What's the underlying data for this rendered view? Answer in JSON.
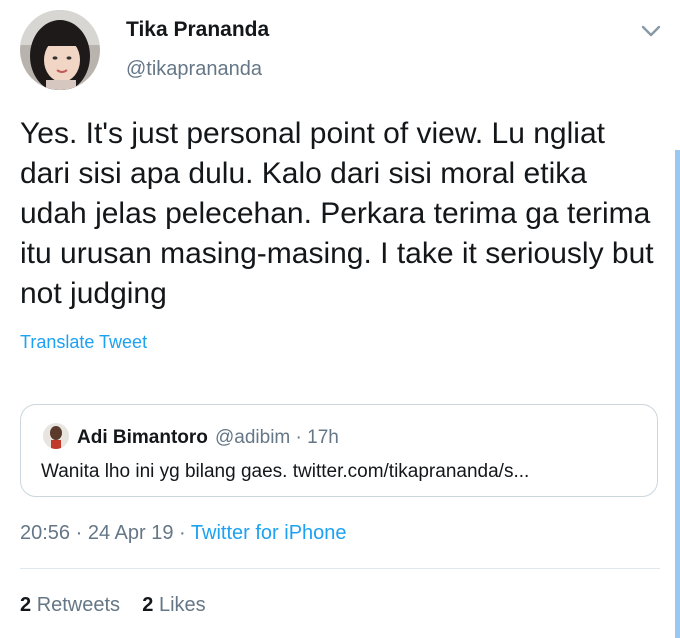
{
  "user": {
    "name": "Tika Prananda",
    "handle": "@tikaprananda"
  },
  "tweet": {
    "text": "Yes. It's just personal point of view. Lu ngliat dari sisi apa dulu. Kalo dari sisi moral etika udah jelas pelecehan. Perkara terima ga terima itu urusan masing-masing. I take it seriously but not judging",
    "translate_label": "Translate Tweet"
  },
  "quoted": {
    "name": "Adi Bimantoro",
    "handle": "@adibim",
    "separator": "·",
    "time": "17h",
    "text": "Wanita lho ini yg bilang gaes. twitter.com/tikaprananda/s..."
  },
  "meta": {
    "time": "20:56",
    "sep1": "·",
    "date": "24 Apr 19",
    "sep2": "·",
    "source": "Twitter for iPhone"
  },
  "stats": {
    "retweets_count": "2",
    "retweets_label": "Retweets",
    "likes_count": "2",
    "likes_label": "Likes"
  },
  "colors": {
    "accent": "#1da1f2",
    "secondary_text": "#657786",
    "border": "#ccd6dd"
  },
  "icons": {
    "menu": "chevron-down-icon"
  }
}
